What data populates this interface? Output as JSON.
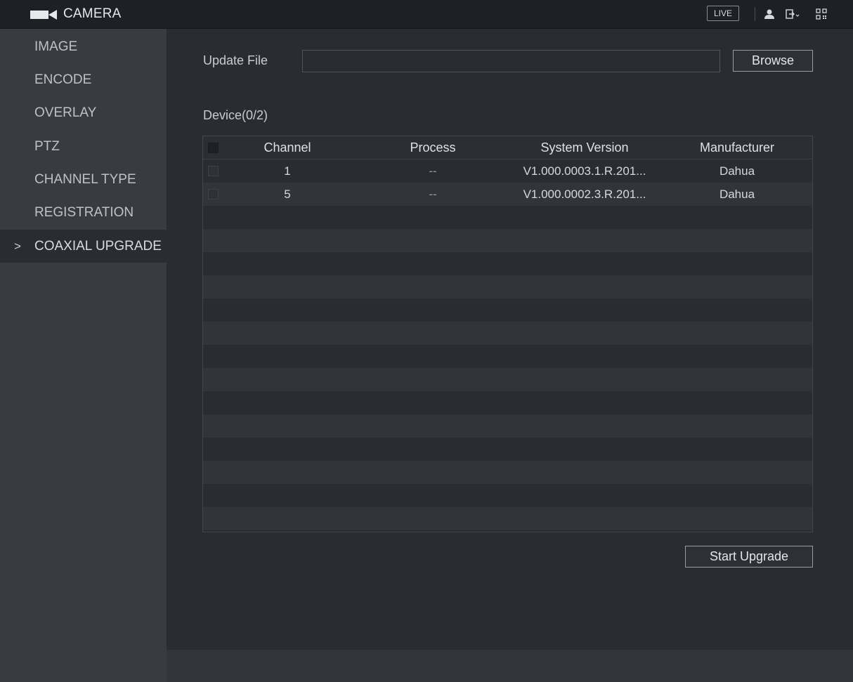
{
  "header": {
    "title": "CAMERA",
    "live_label": "LIVE",
    "icons": [
      "camera-icon",
      "user-icon",
      "logout-icon",
      "qr-code-icon"
    ]
  },
  "sidebar": {
    "items": [
      {
        "label": "IMAGE",
        "active": false
      },
      {
        "label": "ENCODE",
        "active": false
      },
      {
        "label": "OVERLAY",
        "active": false
      },
      {
        "label": "PTZ",
        "active": false
      },
      {
        "label": "CHANNEL TYPE",
        "active": false
      },
      {
        "label": "REGISTRATION",
        "active": false
      },
      {
        "label": "COAXIAL UPGRADE",
        "active": true
      }
    ],
    "active_marker": ">"
  },
  "main": {
    "update_file_label": "Update File",
    "update_file_value": "",
    "browse_label": "Browse",
    "device_label": "Device(0/2)",
    "table": {
      "columns": [
        "Channel",
        "Process",
        "System Version",
        "Manufacturer"
      ],
      "rows": [
        {
          "channel": "1",
          "process": "--",
          "system_version": "V1.000.0003.1.R.201...",
          "manufacturer": "Dahua"
        },
        {
          "channel": "5",
          "process": "--",
          "system_version": "V1.000.0002.3.R.201...",
          "manufacturer": "Dahua"
        }
      ]
    },
    "start_upgrade_label": "Start Upgrade"
  },
  "colors": {
    "background": "#2a2c33",
    "sidebar": "#393b43",
    "topbar": "#1e2026",
    "row_alt": "#32343b",
    "text": "#d2d4d8"
  }
}
